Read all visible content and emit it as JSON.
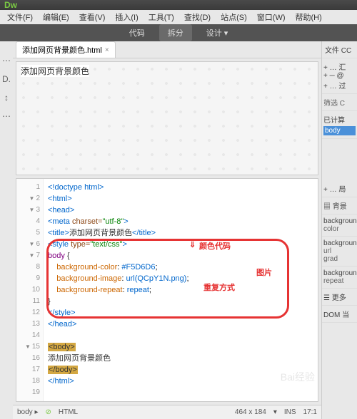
{
  "logo": "Dw",
  "menu": {
    "file": "文件(F)",
    "edit": "编辑(E)",
    "view": "查看(V)",
    "insert": "插入(I)",
    "tool": "工具(T)",
    "find": "查找(D)",
    "site": "站点(S)",
    "window": "窗口(W)",
    "help": "帮助(H)"
  },
  "viewbar": {
    "code": "代码",
    "split": "拆分",
    "design": "设计 ▾"
  },
  "tab": {
    "name": "添加网页背景颜色.html",
    "close": "×"
  },
  "preview_title": "添加网页背景颜色",
  "lines": {
    "l1": "<!doctype html>",
    "l2": "<html>",
    "l3": "<head>",
    "l4a": "<meta ",
    "l4b": "charset=",
    "l4c": "\"utf-8\"",
    "l4d": ">",
    "l5a": "<title>",
    "l5b": "添加网页背景颜色",
    "l5c": "</title>",
    "l6a": "<style ",
    "l6b": "type=",
    "l6c": "\"text/css\"",
    "l6d": ">",
    "l7a": "body",
    "l7b": " {",
    "l8a": "background-color",
    "l8b": ": ",
    "l8c": "#F5D6D6",
    "l8d": ";",
    "l9a": "background-image",
    "l9b": ": ",
    "l9c": "url(QCpY1N.png)",
    "l9d": ";",
    "l10a": "background-repeat",
    "l10b": ": ",
    "l10c": "repeat",
    "l10d": ";",
    "l11": "}",
    "l12": "</style>",
    "l13": "</head>",
    "l14": "",
    "l15": "<body>",
    "l16": "添加网页背景颜色",
    "l17": "</body>",
    "l18": "</html>"
  },
  "anno": {
    "arrow": "⇓",
    "a1": "颜色代码",
    "a2": "图片",
    "a3": "重复方式"
  },
  "status": {
    "path": "body ▸",
    "play": "⊘",
    "lang": "HTML",
    "dim": "464 x 184",
    "selmode": "▾",
    "ins": "INS",
    "pos": "17:1"
  },
  "right": {
    "tab1": "文件",
    "tab2": "CC",
    "sec1a": "+  …  汇",
    "sec1b": "+  ─  @",
    "sec1c": "+  …  过",
    "filter": "筛选 C",
    "computed": "已计算",
    "body": "body",
    "sec2": "+  …  局",
    "bg_label": "背景",
    "p1": "backgroun",
    "p1v": "color",
    "p2": "backgroun",
    "p2v": "url",
    "p2v2": "grad",
    "p3": "backgroun",
    "p3v": "repeat",
    "more": "更多",
    "dom": "DOM",
    "cur": "当"
  },
  "watermark": "Bai经验"
}
